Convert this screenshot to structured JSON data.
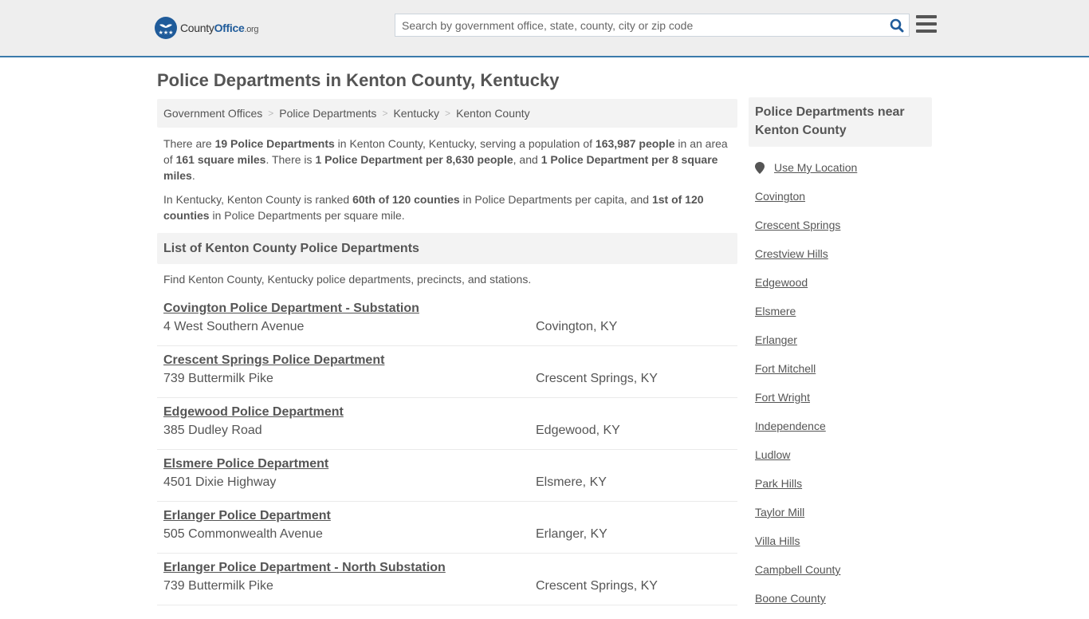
{
  "header": {
    "logo": {
      "name_part1": "County",
      "name_part2": "Office",
      "suffix": ".org"
    },
    "search": {
      "placeholder": "Search by government office, state, county, city or zip code",
      "value": ""
    },
    "icons": {
      "search": "search-icon",
      "menu": "hamburger-menu-icon",
      "logo": "eagle-stars-logo-icon"
    }
  },
  "page": {
    "title": "Police Departments in Kenton County, Kentucky"
  },
  "breadcrumb": [
    {
      "label": "Government Offices"
    },
    {
      "label": "Police Departments"
    },
    {
      "label": "Kentucky"
    },
    {
      "label": "Kenton County"
    }
  ],
  "breadcrumb_separator": ">",
  "intro": {
    "p1": {
      "t1": "There are ",
      "b1": "19 Police Departments",
      "t2": " in Kenton County, Kentucky, serving a population of ",
      "b2": "163,987 people",
      "t3": " in an area of ",
      "b3": "161 square miles",
      "t4": ". There is ",
      "b4": "1 Police Department per 8,630 people",
      "t5": ", and ",
      "b5": "1 Police Department per 8 square miles",
      "t6": "."
    },
    "p2": {
      "t1": "In Kentucky, Kenton County is ranked ",
      "b1": "60th of 120 counties",
      "t2": " in Police Departments per capita, and ",
      "b2": "1st of 120 counties",
      "t3": " in Police Departments per square mile."
    }
  },
  "list": {
    "heading": "List of Kenton County Police Departments",
    "description": "Find Kenton County, Kentucky police departments, precincts, and stations.",
    "items": [
      {
        "name": "Covington Police Department - Substation",
        "address": "4 West Southern Avenue",
        "city": "Covington, KY"
      },
      {
        "name": "Crescent Springs Police Department",
        "address": "739 Buttermilk Pike",
        "city": "Crescent Springs, KY"
      },
      {
        "name": "Edgewood Police Department",
        "address": "385 Dudley Road",
        "city": "Edgewood, KY"
      },
      {
        "name": "Elsmere Police Department",
        "address": "4501 Dixie Highway",
        "city": "Elsmere, KY"
      },
      {
        "name": "Erlanger Police Department",
        "address": "505 Commonwealth Avenue",
        "city": "Erlanger, KY"
      },
      {
        "name": "Erlanger Police Department - North Substation",
        "address": "739 Buttermilk Pike",
        "city": "Crescent Springs, KY"
      }
    ]
  },
  "sidebar": {
    "heading": "Police Departments near Kenton County",
    "use_location": "Use My Location",
    "links": [
      "Covington",
      "Crescent Springs",
      "Crestview Hills",
      "Edgewood",
      "Elsmere",
      "Erlanger",
      "Fort Mitchell",
      "Fort Wright",
      "Independence",
      "Ludlow",
      "Park Hills",
      "Taylor Mill",
      "Villa Hills",
      "Campbell County",
      "Boone County"
    ]
  },
  "colors": {
    "header_bg": "#eeeeee",
    "accent_border": "#3b7aab",
    "brand_blue": "#1f5b9a",
    "text": "#555555",
    "panel_bg": "#f3f3f3"
  }
}
